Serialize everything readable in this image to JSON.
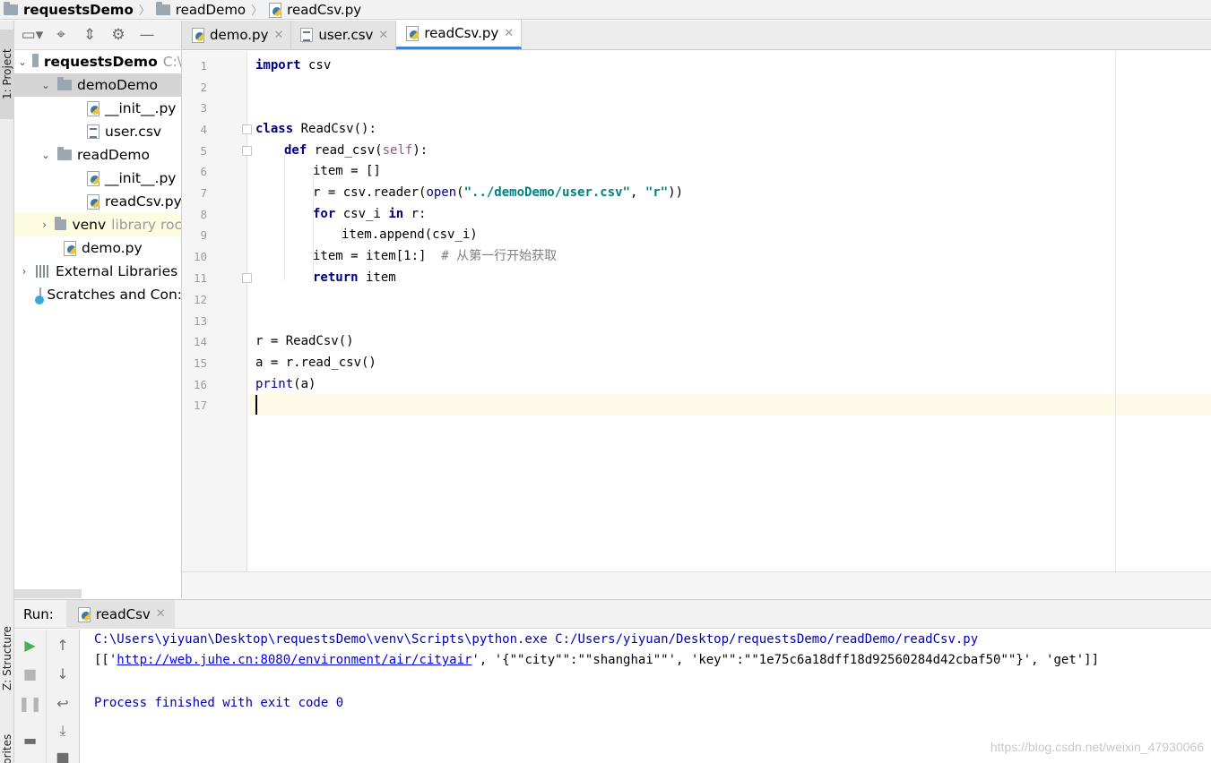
{
  "breadcrumb": {
    "items": [
      "requestsDemo",
      "readDemo",
      "readCsv.py"
    ]
  },
  "side_tabs": {
    "project": "1: Project",
    "structure": "Z: Structure",
    "favorites": "Favorites"
  },
  "project_tree": {
    "root": {
      "name": "requestsDemo",
      "path_hint": "C:\\"
    },
    "demoDemo": {
      "name": "demoDemo",
      "children": [
        "__init__.py",
        "user.csv"
      ]
    },
    "readDemo": {
      "name": "readDemo",
      "children": [
        "__init__.py",
        "readCsv.py"
      ]
    },
    "venv": {
      "name": "venv",
      "hint": "library roc"
    },
    "demo_py": "demo.py",
    "external_libraries": "External Libraries",
    "scratches": "Scratches and Con:"
  },
  "editor_tabs": [
    {
      "label": "demo.py",
      "active": false
    },
    {
      "label": "user.csv",
      "active": false
    },
    {
      "label": "readCsv.py",
      "active": true
    }
  ],
  "code": {
    "line_numbers": [
      "1",
      "2",
      "3",
      "4",
      "5",
      "6",
      "7",
      "8",
      "9",
      "10",
      "11",
      "12",
      "13",
      "14",
      "15",
      "16",
      "17"
    ],
    "l1_kw": "import",
    "l1_rest": " csv",
    "l4_kw": "class",
    "l4_rest": " ReadCsv():",
    "l5_kw": "def",
    "l5_name": " read_csv(",
    "l5_self": "self",
    "l5_end": "):",
    "l6": "item = []",
    "l7_a": "r = csv.reader(",
    "l7_open": "open",
    "l7_b": "(",
    "l7_s1": "\"../demoDemo/user.csv\"",
    "l7_c": ", ",
    "l7_s2": "\"r\"",
    "l7_d": "))",
    "l8_kw1": "for",
    "l8_mid": " csv_i ",
    "l8_kw2": "in",
    "l8_end": " r:",
    "l9": "item.append(csv_i)",
    "l10_code": "item = item[1:]",
    "l10_comment": "  # 从第一行开始获取",
    "l11_kw": "return",
    "l11_rest": " item",
    "l14": "r = ReadCsv()",
    "l15": "a = r.read_csv()",
    "l16_fn": "print",
    "l16_rest": "(a)"
  },
  "run": {
    "title": "Run:",
    "tab": "readCsv",
    "console": {
      "cmd": "C:\\Users\\yiyuan\\Desktop\\requestsDemo\\venv\\Scripts\\python.exe C:/Users/yiyuan/Desktop/requestsDemo/readDemo/readCsv.py",
      "out_prefix": "[['",
      "out_link": "http://web.juhe.cn:8080/environment/air/cityair",
      "out_suffix": "', '{\"\"city\"\":\"\"shanghai\"\"', 'key\"\":\"\"1e75c6a18dff18d92560284d42cbaf50\"\"}', 'get']]",
      "exit": "Process finished with exit code 0"
    }
  },
  "watermark": "https://blog.csdn.net/weixin_47930066",
  "colors": {
    "keyword": "#000080",
    "string": "#008080",
    "self": "#94558d",
    "comment": "#808080",
    "run_green": "#4caf50",
    "tab_underline": "#4083c9"
  }
}
